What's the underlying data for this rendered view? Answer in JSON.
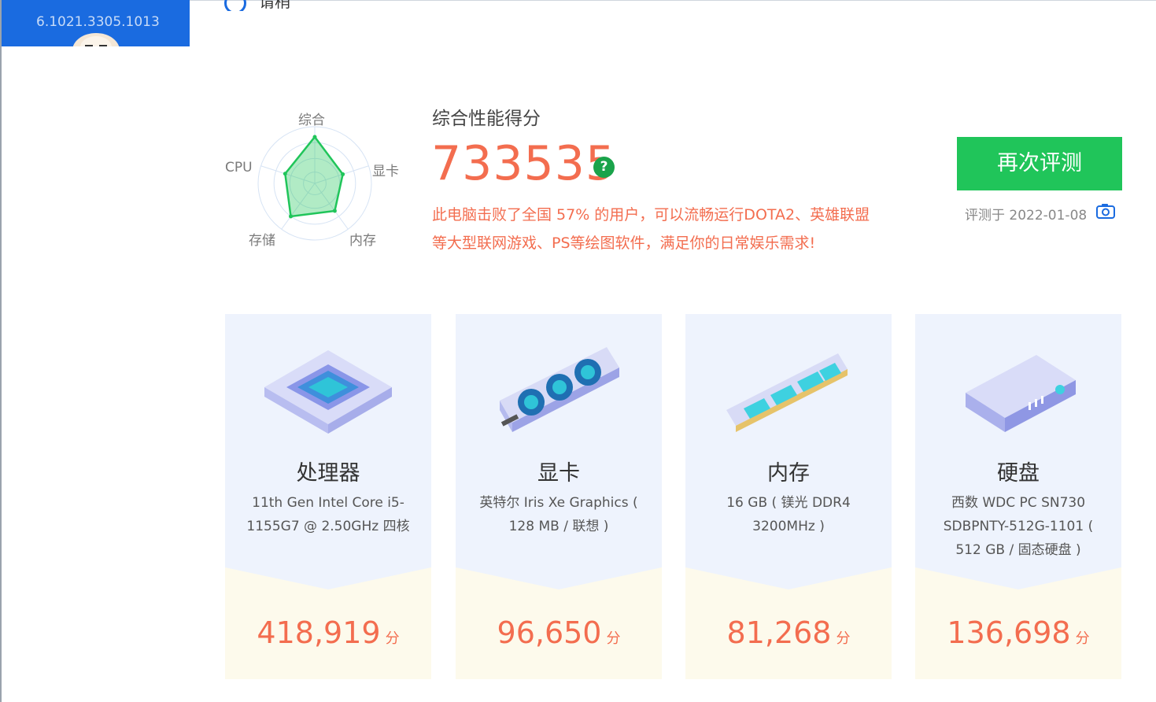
{
  "header": {
    "version_text": "6.1021.3305.1013",
    "cut_title_text": "请稍"
  },
  "radar": {
    "labels": [
      "综合",
      "显卡",
      "内存",
      "存储",
      "CPU"
    ],
    "values": [
      0.82,
      0.52,
      0.6,
      0.72,
      0.55
    ],
    "color": "#20c55a"
  },
  "summary": {
    "heading": "综合性能得分",
    "score": "733535",
    "help_glyph": "?",
    "desc_line1": "此电脑击败了全国 57% 的用户，可以流畅运行DOTA2、英雄联盟",
    "desc_line2": "等大型联网游戏、PS等绘图软件，满足你的日常娱乐需求!",
    "retest_label": "再次评测",
    "date_text": "评测于 2022-01-08"
  },
  "cards": [
    {
      "title": "处理器",
      "detail": "11th Gen Intel Core i5-1155G7 @ 2.50GHz 四核",
      "score": "418,919",
      "unit": "分",
      "icon": "cpu-icon"
    },
    {
      "title": "显卡",
      "detail": "英特尔 Iris Xe Graphics ( 128 MB / 联想 )",
      "score": "96,650",
      "unit": "分",
      "icon": "graphics-card-icon"
    },
    {
      "title": "内存",
      "detail": "16 GB ( 镁光 DDR4 3200MHz )",
      "score": "81,268",
      "unit": "分",
      "icon": "memory-stick-icon"
    },
    {
      "title": "硬盘",
      "detail": "西数 WDC PC SN730 SDBPNTY-512G-1101 ( 512 GB / 固态硬盘 )",
      "score": "136,698",
      "unit": "分",
      "icon": "hard-drive-icon"
    }
  ],
  "colors": {
    "accent": "#1a6be0",
    "score": "#f36d4f",
    "button": "#20c55a",
    "card_top": "#eef3fd",
    "card_bottom": "#fdfaec"
  }
}
